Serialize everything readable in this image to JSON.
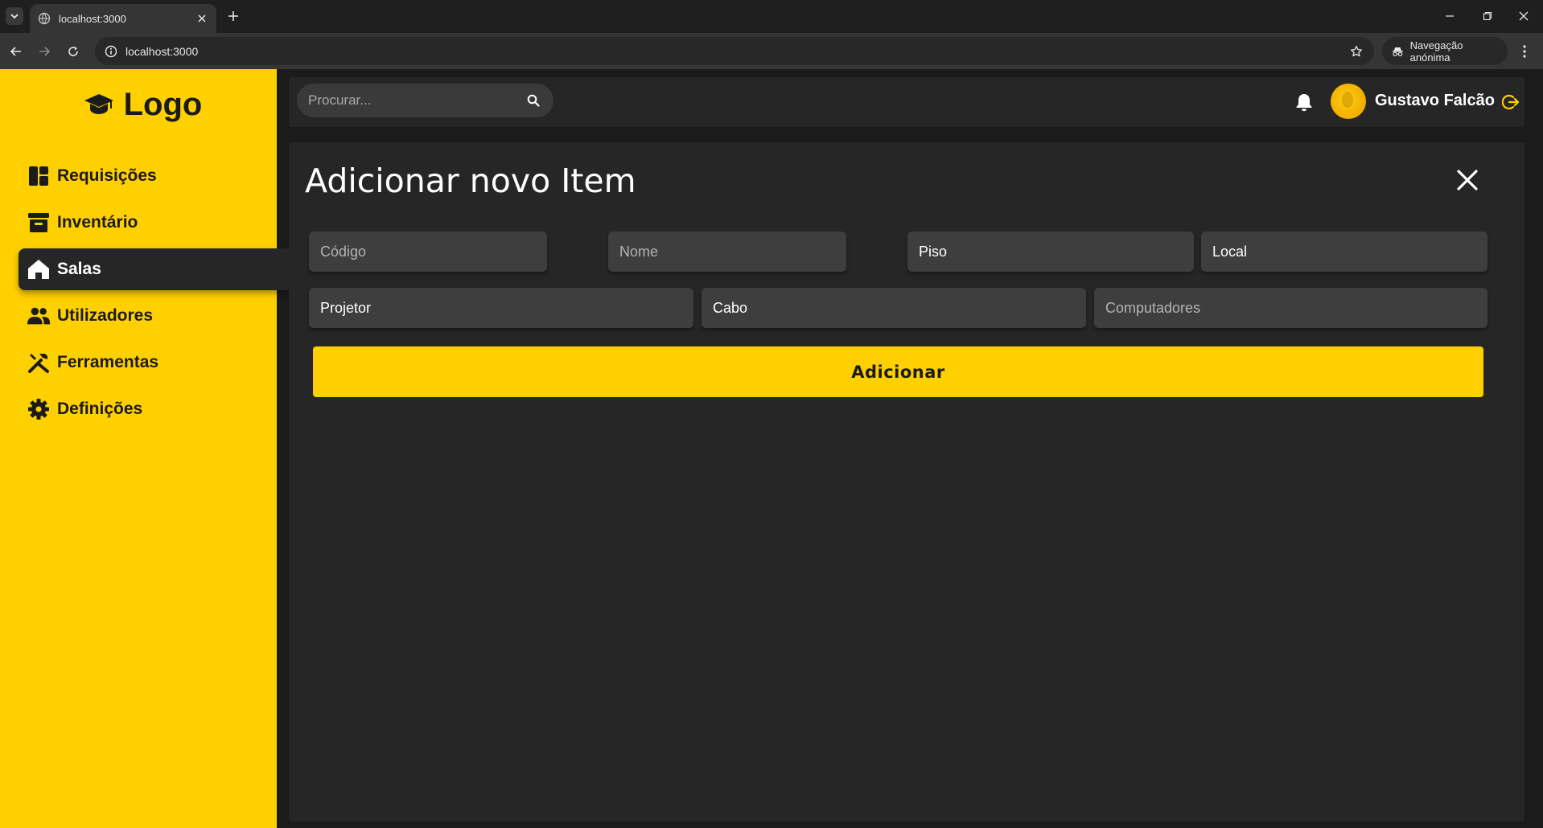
{
  "browser": {
    "tab_title": "localhost:3000",
    "url": "localhost:3000",
    "incognito_label": "Navegação anónima"
  },
  "sidebar": {
    "logo_text": "Logo",
    "items": [
      {
        "label": "Requisições",
        "icon": "dashboard-icon",
        "active": false
      },
      {
        "label": "Inventário",
        "icon": "archive-icon",
        "active": false
      },
      {
        "label": "Salas",
        "icon": "home-icon",
        "active": true
      },
      {
        "label": "Utilizadores",
        "icon": "people-icon",
        "active": false
      },
      {
        "label": "Ferramentas",
        "icon": "tools-icon",
        "active": false
      },
      {
        "label": "Definições",
        "icon": "gear-icon",
        "active": false
      }
    ]
  },
  "header": {
    "search_placeholder": "Procurar...",
    "user_name": "Gustavo Falcão"
  },
  "form": {
    "title": "Adicionar novo Item",
    "fields": {
      "codigo_placeholder": "Código",
      "nome_placeholder": "Nome",
      "piso_value": "Piso",
      "local_value": "Local",
      "projetor_value": "Projetor",
      "cabo_value": "Cabo",
      "computadores_placeholder": "Computadores"
    },
    "submit_label": "Adicionar"
  },
  "colors": {
    "accent": "#ffd000",
    "panel": "#262626",
    "background": "#1b1b1b",
    "field": "#3e3e3e"
  }
}
